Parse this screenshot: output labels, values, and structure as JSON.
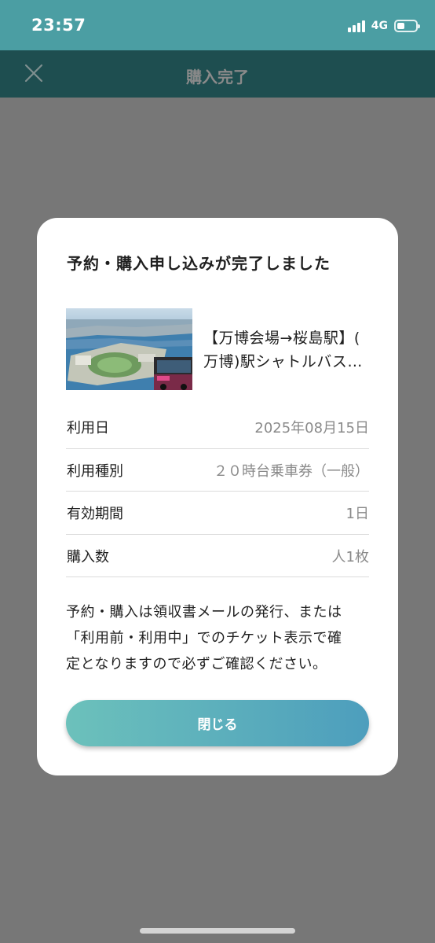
{
  "status_bar": {
    "time": "23:57",
    "network": "4G",
    "battery_level": 0.4
  },
  "nav": {
    "title": "購入完了",
    "close_icon": "close-icon"
  },
  "modal": {
    "title": "予約・購入申し込みが完了しました",
    "product": {
      "name_line1": "【万博会場→桜島駅】(",
      "name_line2": "万博)駅シャトルバス…"
    },
    "details": [
      {
        "label": "利用日",
        "value": "2025年08月15日"
      },
      {
        "label": "利用種別",
        "value": "２０時台乗車券（一般）"
      },
      {
        "label": "有効期間",
        "value": "1日"
      },
      {
        "label": "購入数",
        "value": "人1枚"
      }
    ],
    "notice_lines": [
      "予約・購入は領収書メールの発行、または",
      "「利用前・利用中」でのチケット表示で確",
      "定となりますので必ずご確認ください。"
    ],
    "close_button_label": "閉じる"
  },
  "colors": {
    "status_bar": "#4b9ea3",
    "nav_bar": "#1e4e50",
    "overlay": "#777777",
    "button_gradient_start": "#6cc1bb",
    "button_gradient_end": "#4d9ebd"
  }
}
